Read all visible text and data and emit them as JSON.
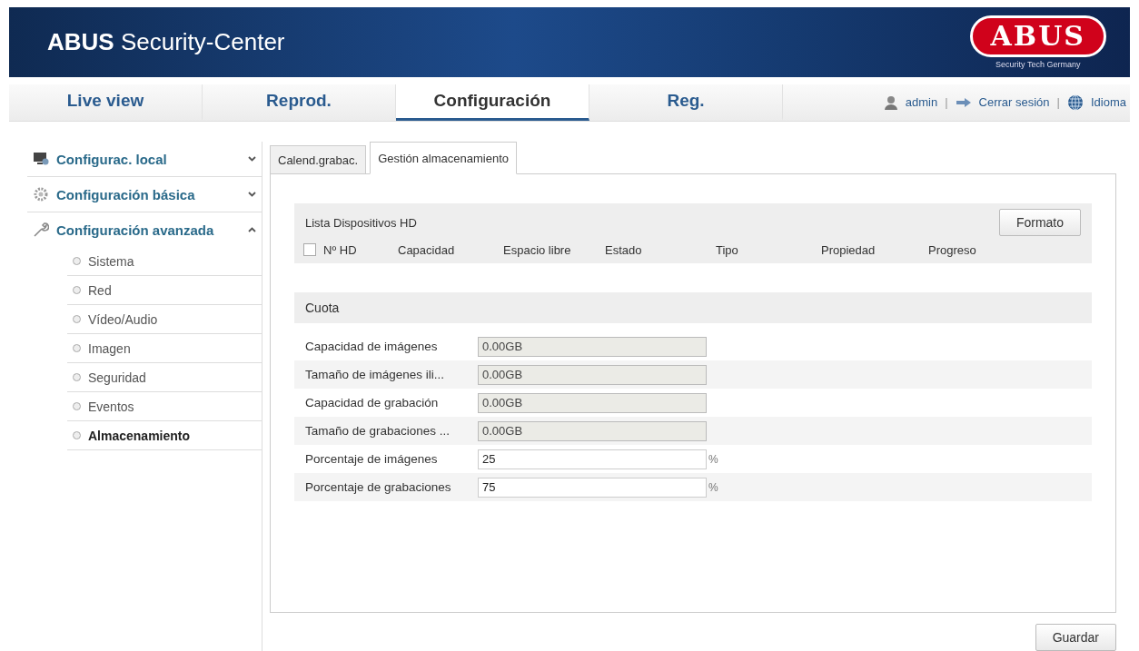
{
  "header": {
    "title_bold": "ABUS",
    "title": "Security-Center",
    "logo": "ABUS",
    "logo_tagline": "Security Tech Germany"
  },
  "nav": {
    "tabs": [
      {
        "label": "Live view",
        "selected": false
      },
      {
        "label": "Reprod.",
        "selected": false
      },
      {
        "label": "Configuración",
        "selected": true
      },
      {
        "label": "Reg.",
        "selected": false
      }
    ],
    "user": "admin",
    "separator": "|",
    "logout": "Cerrar sesión",
    "separator_2": "|",
    "language": "Idioma"
  },
  "sidebar": {
    "groups": [
      {
        "label": "Configurac. local",
        "expanded": false
      },
      {
        "label": "Configuración básica",
        "expanded": false
      },
      {
        "label": "Configuración avanzada",
        "expanded": true,
        "children": [
          {
            "label": "Sistema",
            "selected": false
          },
          {
            "label": "Red",
            "selected": false
          },
          {
            "label": "Vídeo/Audio",
            "selected": false
          },
          {
            "label": "Imagen",
            "selected": false
          },
          {
            "label": "Seguridad",
            "selected": false
          },
          {
            "label": "Eventos",
            "selected": false
          },
          {
            "label": "Almacenamiento",
            "selected": true
          }
        ]
      }
    ]
  },
  "subtabs": [
    {
      "label": "Calend.grabac.",
      "selected": false
    },
    {
      "label": "Gestión almacenamiento",
      "selected": true
    }
  ],
  "hd_list": {
    "title": "Lista Dispositivos HD",
    "format_button": "Formato",
    "select_all_checked": false,
    "columns": [
      "Nº HD",
      "Capacidad",
      "Espacio libre",
      "Estado",
      "Tipo",
      "Propiedad",
      "Progreso"
    ]
  },
  "quota": {
    "title": "Cuota",
    "rows": [
      {
        "label": "Capacidad de imágenes",
        "value": "0.00GB",
        "disabled": true
      },
      {
        "label": "Tamaño de imágenes ili...",
        "value": "0.00GB",
        "disabled": true
      },
      {
        "label": "Capacidad de grabación",
        "value": "0.00GB",
        "disabled": true
      },
      {
        "label": "Tamaño de grabaciones ...",
        "value": "0.00GB",
        "disabled": true
      },
      {
        "label": "Porcentaje de imágenes",
        "value": "25",
        "disabled": false,
        "unit": "%"
      },
      {
        "label": "Porcentaje de grabaciones",
        "value": "75",
        "disabled": false,
        "unit": "%"
      }
    ]
  },
  "save_button": "Guardar"
}
